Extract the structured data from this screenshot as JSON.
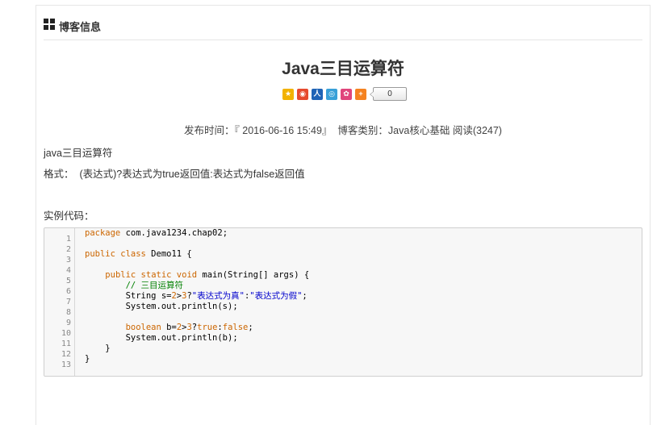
{
  "panel": {
    "title": "博客信息"
  },
  "post": {
    "title": "Java三目运算符",
    "share": {
      "icons": [
        "qzone-icon",
        "weibo-icon",
        "renren-icon",
        "tencent-weibo-icon",
        "douban-icon",
        "more-share-icon"
      ],
      "count": "0"
    },
    "meta": {
      "publish_label": "发布时间：",
      "publish_time": "『 2016-06-16 15:49』",
      "category_label": "博客类别：",
      "category": "Java核心基础",
      "read_label": "阅读",
      "read_count": "(3247)"
    },
    "body": {
      "line1": "java三目运算符",
      "line2": "格式：  (表达式)?表达式为true返回值:表达式为false返回值",
      "line3": "实例代码："
    },
    "code": {
      "line_numbers": [
        "1",
        "2",
        "3",
        "4",
        "5",
        "6",
        "7",
        "8",
        "9",
        "10",
        "11",
        "12",
        "13"
      ],
      "lines": [
        [
          {
            "t": "kw",
            "v": "package"
          },
          {
            "t": "p",
            "v": " com.java1234.chap02;"
          }
        ],
        [
          {
            "t": "p",
            "v": " "
          }
        ],
        [
          {
            "t": "kw",
            "v": "public class"
          },
          {
            "t": "p",
            "v": " Demo11 {"
          }
        ],
        [
          {
            "t": "p",
            "v": " "
          }
        ],
        [
          {
            "t": "p",
            "v": "    "
          },
          {
            "t": "kw",
            "v": "public static void"
          },
          {
            "t": "p",
            "v": " main(String[] args) {"
          }
        ],
        [
          {
            "t": "cm",
            "v": "        // 三目运算符"
          }
        ],
        [
          {
            "t": "p",
            "v": "        String s="
          },
          {
            "t": "num",
            "v": "2"
          },
          {
            "t": "p",
            "v": ">"
          },
          {
            "t": "num",
            "v": "3"
          },
          {
            "t": "p",
            "v": "?"
          },
          {
            "t": "str",
            "v": "\"表达式为真\""
          },
          {
            "t": "p",
            "v": ":"
          },
          {
            "t": "str",
            "v": "\"表达式为假\""
          },
          {
            "t": "p",
            "v": ";"
          }
        ],
        [
          {
            "t": "p",
            "v": "        System.out.println(s);"
          }
        ],
        [
          {
            "t": "p",
            "v": " "
          }
        ],
        [
          {
            "t": "p",
            "v": "        "
          },
          {
            "t": "kw",
            "v": "boolean"
          },
          {
            "t": "p",
            "v": " b="
          },
          {
            "t": "num",
            "v": "2"
          },
          {
            "t": "p",
            "v": ">"
          },
          {
            "t": "num",
            "v": "3"
          },
          {
            "t": "p",
            "v": "?"
          },
          {
            "t": "kw",
            "v": "true"
          },
          {
            "t": "p",
            "v": ":"
          },
          {
            "t": "kw",
            "v": "false"
          },
          {
            "t": "p",
            "v": ";"
          }
        ],
        [
          {
            "t": "p",
            "v": "        System.out.println(b);"
          }
        ],
        [
          {
            "t": "p",
            "v": "    }"
          }
        ],
        [
          {
            "t": "p",
            "v": "}"
          }
        ]
      ]
    }
  },
  "colors": {
    "keyword": "#cc6600",
    "comment": "#008000",
    "string": "#0000cc",
    "code_bg": "#f7f7f7"
  }
}
